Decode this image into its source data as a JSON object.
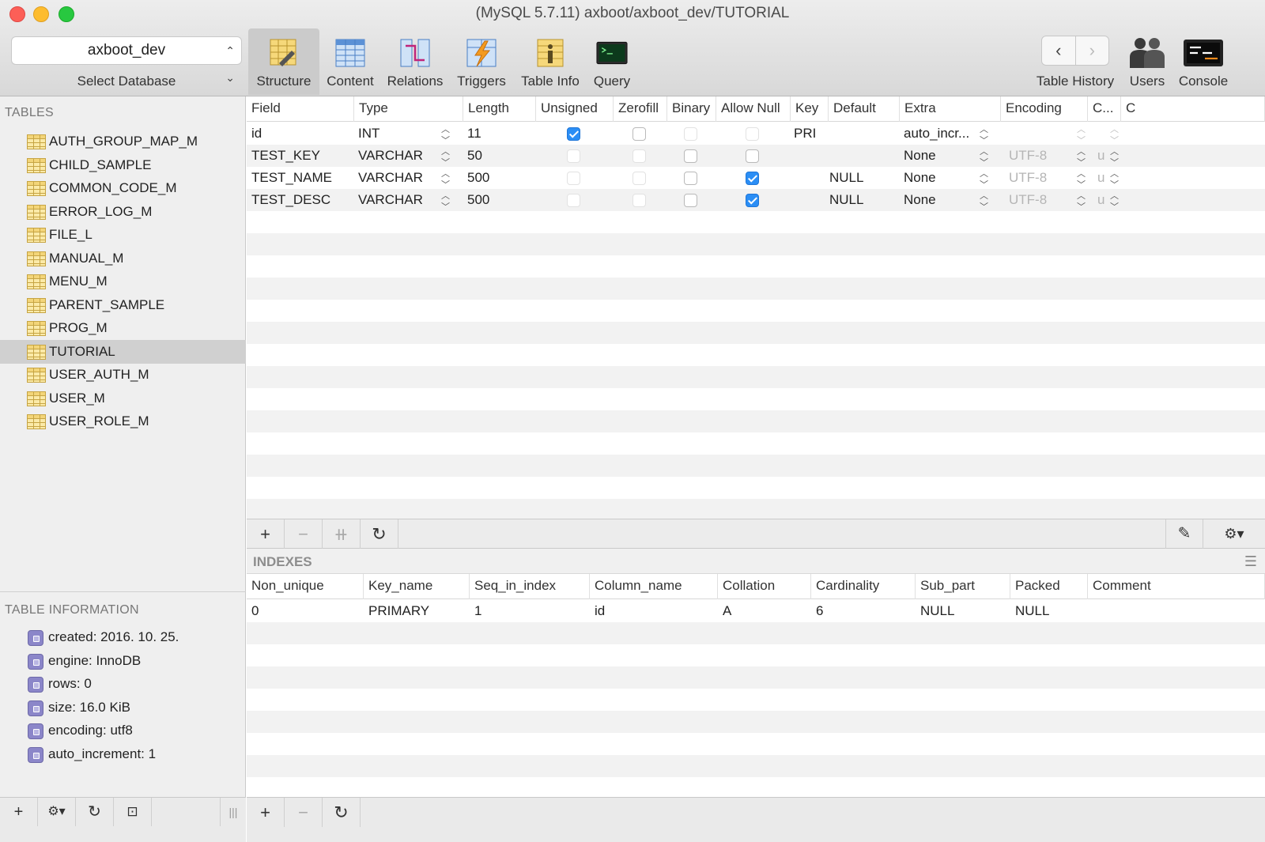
{
  "window": {
    "title": "(MySQL 5.7.11) axboot/axboot_dev/TUTORIAL"
  },
  "toolbar": {
    "database": "axboot_dev",
    "database_label": "Select Database",
    "structure": "Structure",
    "content": "Content",
    "relations": "Relations",
    "triggers": "Triggers",
    "table_info": "Table Info",
    "query": "Query",
    "table_history": "Table History",
    "users": "Users",
    "console": "Console",
    "back": "‹",
    "forward": "›"
  },
  "sidebar": {
    "tables_heading": "TABLES",
    "tables": [
      "AUTH_GROUP_MAP_M",
      "CHILD_SAMPLE",
      "COMMON_CODE_M",
      "ERROR_LOG_M",
      "FILE_L",
      "MANUAL_M",
      "MENU_M",
      "PARENT_SAMPLE",
      "PROG_M",
      "TUTORIAL",
      "USER_AUTH_M",
      "USER_M",
      "USER_ROLE_M"
    ],
    "selected_table": "TUTORIAL",
    "info_heading": "TABLE INFORMATION",
    "info": [
      "created: 2016. 10. 25.",
      "engine: InnoDB",
      "rows: 0",
      "size: 16.0 KiB",
      "encoding: utf8",
      "auto_increment: 1"
    ]
  },
  "fields": {
    "headers": [
      "Field",
      "Type",
      "Length",
      "Unsigned",
      "Zerofill",
      "Binary",
      "Allow Null",
      "Key",
      "Default",
      "Extra",
      "Encoding",
      "C...",
      "C"
    ],
    "rows": [
      {
        "field": "id",
        "type": "INT",
        "length": "11",
        "unsigned": true,
        "zerofill": false,
        "binary": false,
        "allow_null": false,
        "key": "PRI",
        "default": "",
        "extra": "auto_incr...",
        "encoding": "",
        "collation": ""
      },
      {
        "field": "TEST_KEY",
        "type": "VARCHAR",
        "length": "50",
        "unsigned": false,
        "zerofill": false,
        "binary": false,
        "allow_null": false,
        "key": "",
        "default": "",
        "extra": "None",
        "encoding": "UTF-8",
        "collation": "u"
      },
      {
        "field": "TEST_NAME",
        "type": "VARCHAR",
        "length": "500",
        "unsigned": false,
        "zerofill": false,
        "binary": false,
        "allow_null": true,
        "key": "",
        "default": "NULL",
        "extra": "None",
        "encoding": "UTF-8",
        "collation": "u"
      },
      {
        "field": "TEST_DESC",
        "type": "VARCHAR",
        "length": "500",
        "unsigned": false,
        "zerofill": false,
        "binary": false,
        "allow_null": true,
        "key": "",
        "default": "NULL",
        "extra": "None",
        "encoding": "UTF-8",
        "collation": "u"
      }
    ]
  },
  "indexes": {
    "title": "INDEXES",
    "headers": [
      "Non_unique",
      "Key_name",
      "Seq_in_index",
      "Column_name",
      "Collation",
      "Cardinality",
      "Sub_part",
      "Packed",
      "Comment"
    ],
    "rows": [
      [
        "0",
        "PRIMARY",
        "1",
        "id",
        "A",
        "6",
        "NULL",
        "NULL",
        ""
      ]
    ]
  },
  "colors": {
    "accent": "#2b8ef5",
    "selected_row": "#d0d0d0",
    "stripe": "#f2f2f2"
  }
}
